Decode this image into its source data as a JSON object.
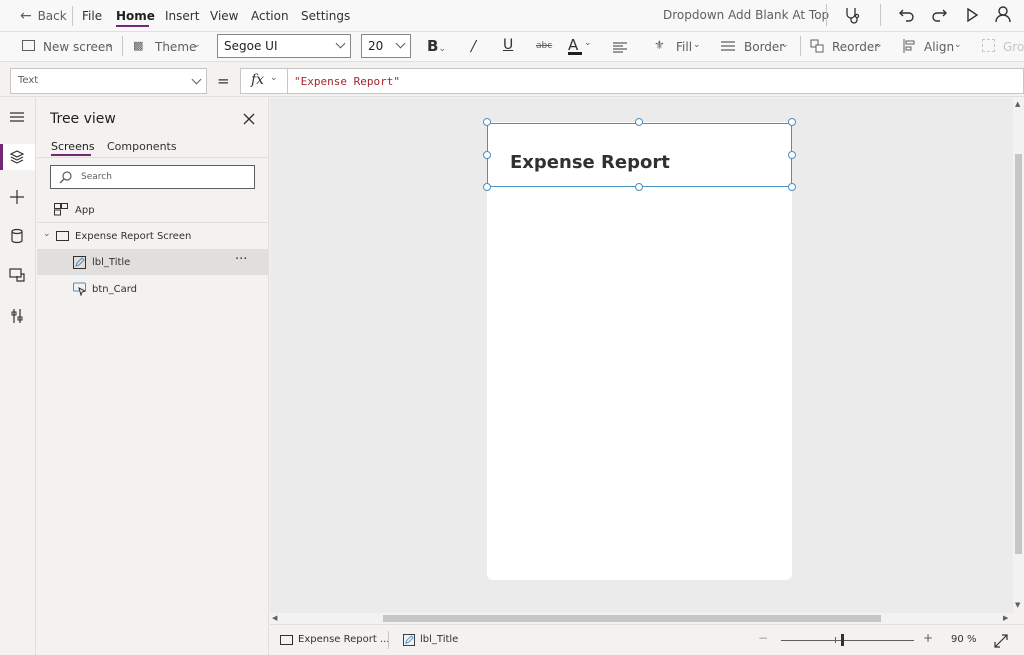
{
  "menubar": {
    "back_label": "Back",
    "items": [
      "File",
      "Home",
      "Insert",
      "View",
      "Action",
      "Settings"
    ],
    "active": "Home",
    "app_title": "Dropdown Add Blank At Top"
  },
  "toolbar": {
    "new_screen": "New screen",
    "theme": "Theme",
    "font": "Segoe UI",
    "font_size": "20",
    "fill": "Fill",
    "border": "Border",
    "reorder": "Reorder",
    "align": "Align",
    "group": "Grou"
  },
  "formula": {
    "property": "Text",
    "equals": "=",
    "fx": "fx",
    "value": "\"Expense Report\""
  },
  "tree": {
    "title": "Tree view",
    "tabs": [
      "Screens",
      "Components"
    ],
    "search_placeholder": "Search",
    "app_label": "App",
    "screen_label": "Expense Report Screen",
    "children": [
      "lbl_Title",
      "btn_Card"
    ],
    "more": "···"
  },
  "canvas": {
    "label_text": "Expense Report"
  },
  "status": {
    "screen_tab": "Expense Report ...",
    "control_tab": "lbl_Title",
    "zoom": "90",
    "zoom_unit": "%",
    "minus": "−",
    "plus": "+"
  },
  "colors": {
    "accent": "#742774",
    "selection": "#4a90c0"
  }
}
